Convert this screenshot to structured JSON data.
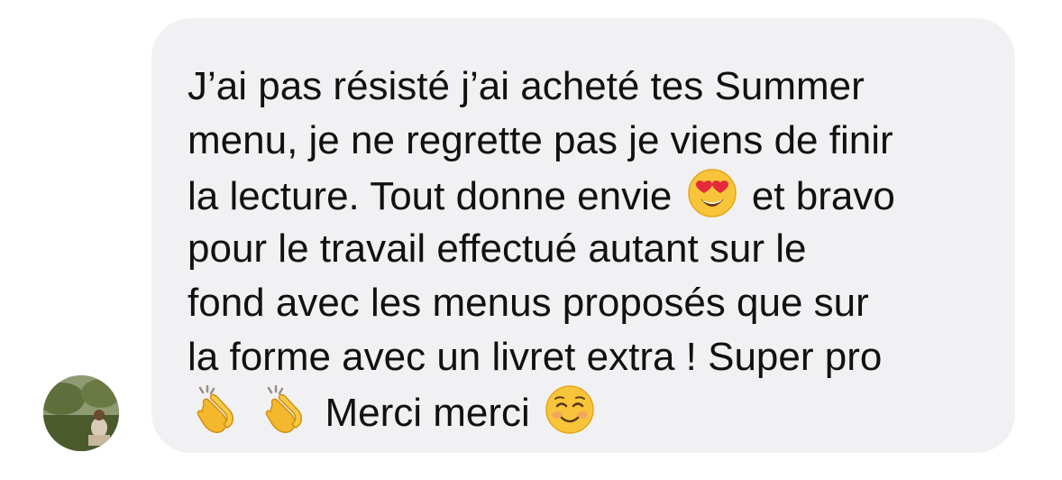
{
  "message": {
    "line1": "J’ai pas résisté j’ai acheté tes Summer",
    "line2": "menu, je ne regrette pas je viens de finir",
    "line3_before": "la lecture. Tout donne envie",
    "line3_after": "et bravo",
    "line4": "pour le travail effectué autant sur le",
    "line5": "fond avec les menus proposés que sur",
    "line6": "la forme avec un livret extra ! Super pro",
    "line7_text": "Merci merci"
  },
  "icons": {
    "avatar": "avatar-photo",
    "emoji_1": "heart-eyes-emoji-icon",
    "emoji_2": "clapping-hands-emoji-icon",
    "emoji_3": "smiling-face-emoji-icon"
  },
  "colors": {
    "bubble_background": "#f1f1f3",
    "text": "#111111"
  }
}
